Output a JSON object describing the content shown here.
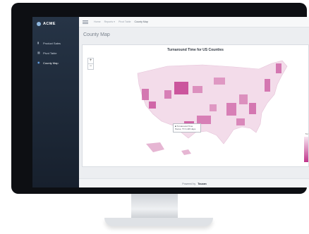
{
  "app": {
    "brand": "ACME"
  },
  "sidebar": {
    "items": [
      {
        "label": "Product Sales",
        "icon": "chart-icon",
        "active": false
      },
      {
        "label": "Pivot Table",
        "icon": "table-icon",
        "active": false
      },
      {
        "label": "County Map",
        "icon": "map-icon",
        "active": true
      }
    ]
  },
  "header": {
    "breadcrumbs": [
      "Home",
      "Reports ▾",
      "Pivot Table",
      "County Map"
    ]
  },
  "main": {
    "page_title": "County Map",
    "map_title": "Turnaround Time for US Counties",
    "zoom_in": "+",
    "zoom_out": "−",
    "tooltip_line1": "■ Turnaround Time",
    "tooltip_line2": "Pecos, TX 3,445 days",
    "legend_label": "Tur"
  },
  "footer": {
    "powered_by": "Powered by",
    "vendor": "Toucan"
  },
  "colors": {
    "accent": "#c0338a",
    "sidebar": "#1f2b3a"
  }
}
